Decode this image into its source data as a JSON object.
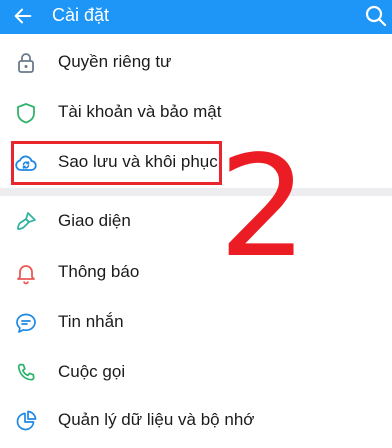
{
  "header": {
    "title": "Cài đặt",
    "back_icon": "back-arrow-icon",
    "search_icon": "search-icon",
    "background": "#1e96f7"
  },
  "settings": {
    "items": [
      {
        "label": "Quyền riêng tư",
        "icon": "lock-icon",
        "color": "#6b7a8a"
      },
      {
        "label": "Tài khoản và bảo mật",
        "icon": "shield-icon",
        "color": "#33b36b"
      },
      {
        "label": "Sao lưu và khôi phục",
        "icon": "cloud-sync-icon",
        "color": "#1e88e5"
      },
      {
        "label": "Giao diện",
        "icon": "paint-brush-icon",
        "color": "#2bb3a0"
      },
      {
        "label": "Thông báo",
        "icon": "bell-icon",
        "color": "#e85a55"
      },
      {
        "label": "Tin nhắn",
        "icon": "message-icon",
        "color": "#1e88e5"
      },
      {
        "label": "Cuộc gọi",
        "icon": "phone-icon",
        "color": "#2bb36b"
      },
      {
        "label": "Quản lý dữ liệu và bộ nhớ",
        "icon": "pie-chart-icon",
        "color": "#1e88e5"
      }
    ]
  },
  "annotation": {
    "step_number": "2",
    "color": "#ec1c24"
  }
}
